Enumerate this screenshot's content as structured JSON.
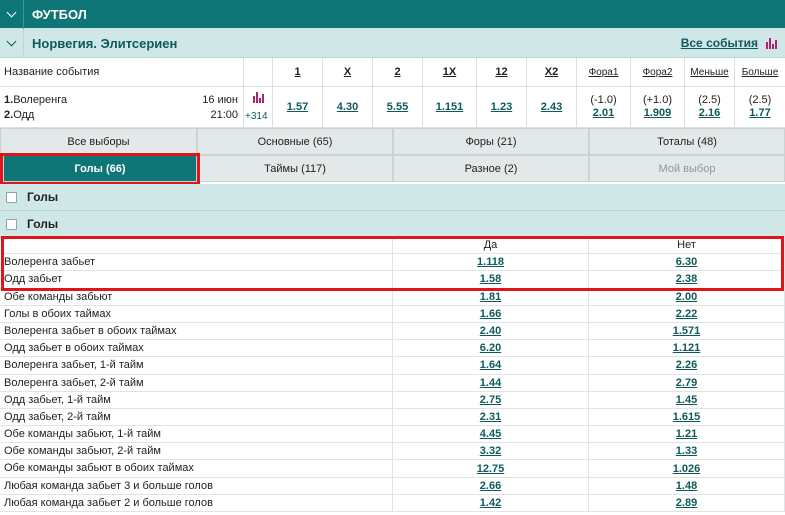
{
  "sport": {
    "title": "ФУТБОЛ"
  },
  "league": {
    "title": "Норвегия. Элитсериен",
    "all_events": "Все события"
  },
  "columns": {
    "event_name": "Название события",
    "headers": [
      "1",
      "X",
      "2",
      "1X",
      "12",
      "X2",
      "Фора1",
      "Фора2",
      "Меньше",
      "Больше"
    ]
  },
  "event": {
    "team1_num": "1.",
    "team1": "Волеренга",
    "team2_num": "2.",
    "team2": "Одд",
    "date": "16 июн",
    "time": "21:00",
    "more_markets": "+314",
    "odds": [
      "1.57",
      "4.30",
      "5.55",
      "1.151",
      "1.23",
      "2.43"
    ],
    "handicaps": [
      {
        "line": "(-1.0)",
        "odd": "2.01"
      },
      {
        "line": "(+1.0)",
        "odd": "1.909"
      },
      {
        "line": "(2.5)",
        "odd": "2.16"
      },
      {
        "line": "(2.5)",
        "odd": "1.77"
      }
    ]
  },
  "tabs": {
    "row1": [
      "Все выборы",
      "Основные (65)",
      "Форы (21)",
      "Тоталы (48)"
    ],
    "row2": [
      "Голы (66)",
      "Таймы (117)",
      "Разное (2)",
      "Мой выбор"
    ],
    "active": "Голы (66)"
  },
  "groups": [
    "Голы",
    "Голы"
  ],
  "market_table": {
    "col_yes": "Да",
    "col_no": "Нет",
    "rows": [
      {
        "name": "Волеренга забьет",
        "yes": "1.118",
        "no": "6.30"
      },
      {
        "name": "Одд забьет",
        "yes": "1.58",
        "no": "2.38"
      },
      {
        "name": "Обе команды забьют",
        "yes": "1.81",
        "no": "2.00"
      },
      {
        "name": "Голы в обоих таймах",
        "yes": "1.66",
        "no": "2.22"
      },
      {
        "name": "Волеренга забьет в обоих таймах",
        "yes": "2.40",
        "no": "1.571"
      },
      {
        "name": "Одд забьет в обоих таймах",
        "yes": "6.20",
        "no": "1.121"
      },
      {
        "name": "Волеренга забьет, 1-й тайм",
        "yes": "1.64",
        "no": "2.26"
      },
      {
        "name": "Волеренга забьет, 2-й тайм",
        "yes": "1.44",
        "no": "2.79"
      },
      {
        "name": "Одд забьет, 1-й тайм",
        "yes": "2.75",
        "no": "1.45"
      },
      {
        "name": "Одд забьет, 2-й тайм",
        "yes": "2.31",
        "no": "1.615"
      },
      {
        "name": "Обе команды забьют, 1-й тайм",
        "yes": "4.45",
        "no": "1.21"
      },
      {
        "name": "Обе команды забьют, 2-й тайм",
        "yes": "3.32",
        "no": "1.33"
      },
      {
        "name": "Обе команды забьют в обоих таймах",
        "yes": "12.75",
        "no": "1.026"
      },
      {
        "name": "Любая команда забьет 3 и больше голов",
        "yes": "2.66",
        "no": "1.48"
      },
      {
        "name": "Любая команда забьет 2 и больше голов",
        "yes": "1.42",
        "no": "2.89"
      }
    ]
  },
  "colors": {
    "primary": "#0e7676",
    "light": "#cfe7e7",
    "highlight": "#e0151b",
    "stats": "#b0226c"
  }
}
